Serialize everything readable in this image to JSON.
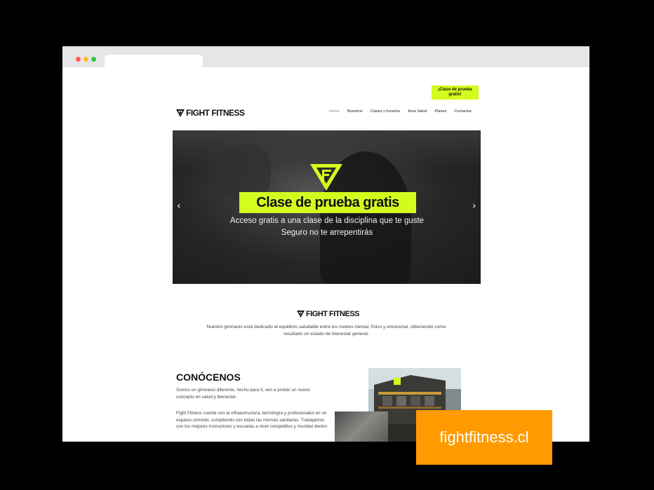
{
  "browser": {
    "colors": {
      "dot_red": "#ff5f57",
      "dot_yellow": "#febc2e",
      "dot_green": "#28c840"
    },
    "nav_icons": {
      "back": "←",
      "forward": "→",
      "reload": "↻"
    }
  },
  "site": {
    "cta_top": "¡Clase de prueba gratis!",
    "logo_text": "FIGHT FITNESS",
    "nav": [
      "Home",
      "Nosotros",
      "Clases y horarios",
      "Area Salud",
      "Planes",
      "Contactos"
    ],
    "hero": {
      "title": "Clase de prueba gratis",
      "subtitle_line1": "Acceso gratis a una clase de la disciplina que te guste",
      "subtitle_line2": "Seguro no te arrepentirás",
      "prev": "‹",
      "next": "›"
    },
    "intro_text": "Nuestro gimnasio está dedicado al equilibrio saludable entre los niveles mental, físico y emocional, obteniendo como resultado un estado de bienestar general.",
    "about": {
      "heading": "CONÓCENOS",
      "para1": "Somos un gimnasio diferente, hecho para ti, ven a probar un nuevo concepto en salud y bienestar.",
      "para2": "Fight Fitness cuenta con la infraestructura, tecnología y profesionales en un espacio cómodo, cumpliendo con todas las normas sanitarias. Trabajamos con los mejores instructores y escuelas a nivel competitivo y mundial dentro"
    },
    "accent_color": "#d4fb1e"
  },
  "badge": {
    "domain": "fightfitness.cl",
    "color": "#ff9b00"
  }
}
